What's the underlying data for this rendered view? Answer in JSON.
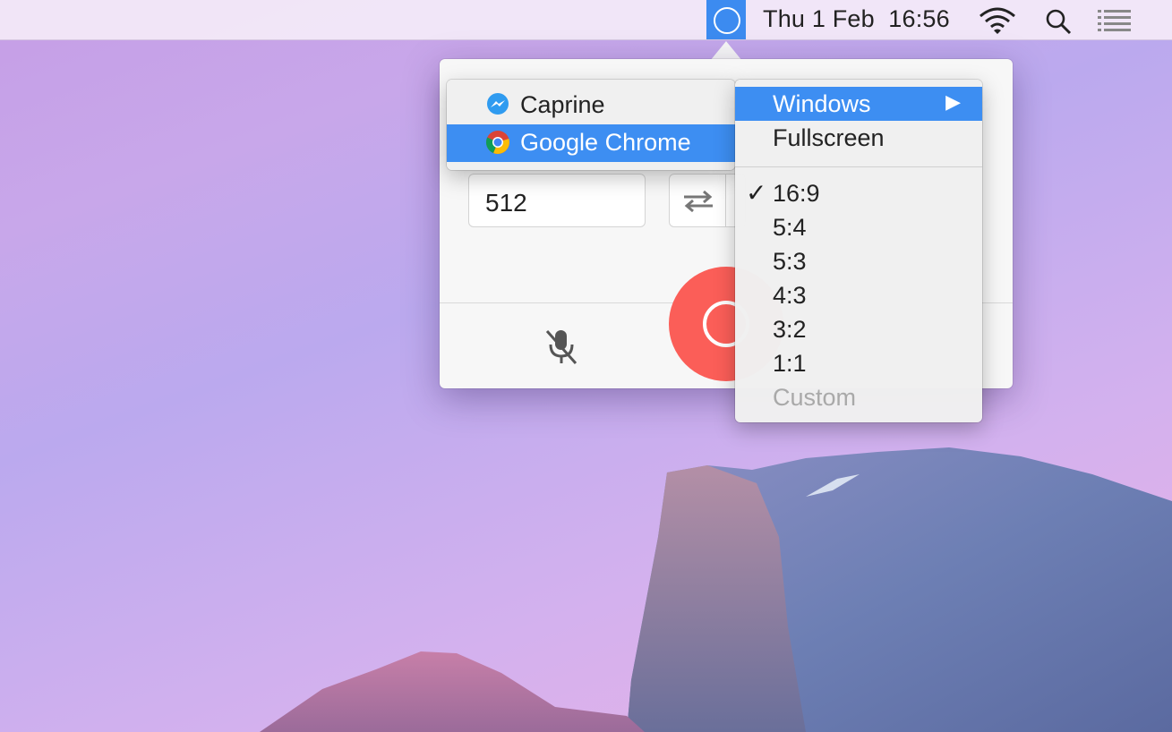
{
  "menubar": {
    "datetime": "Thu 1 Feb  16:56",
    "icons": [
      "app-record-icon",
      "wifi-icon",
      "spotlight-search-icon",
      "notification-center-icon"
    ],
    "accent": "#3c8bf0"
  },
  "popover": {
    "width_value": "512",
    "record_color": "#fb5e58"
  },
  "app_menu": {
    "items": [
      {
        "label": "Caprine",
        "icon": "caprine-messenger-icon",
        "selected": false
      },
      {
        "label": "Google Chrome",
        "icon": "google-chrome-icon",
        "selected": true
      }
    ]
  },
  "ratio_menu": {
    "windows_label": "Windows",
    "fullscreen_label": "Fullscreen",
    "checkmark": "✓",
    "submenu_arrow": "▶",
    "ratios": [
      "16:9",
      "5:4",
      "5:3",
      "4:3",
      "3:2",
      "1:1"
    ],
    "selected_ratio": "16:9",
    "custom_label": "Custom"
  }
}
